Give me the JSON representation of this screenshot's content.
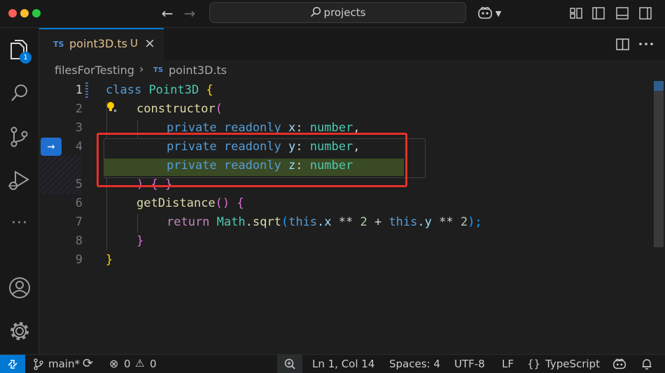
{
  "titlebar": {
    "search_text": "projects",
    "traffic_colors": [
      "#ff5f57",
      "#febc2e",
      "#28c840"
    ]
  },
  "activity": {
    "explorer_badge": "1",
    "more_label": "···"
  },
  "tab": {
    "lang_badge": "TS",
    "file_name": "point3D.ts",
    "status": "U",
    "close": "×"
  },
  "breadcrumb": {
    "folder": "filesForTesting",
    "separator": "›",
    "lang_badge": "TS",
    "file": "point3D.ts"
  },
  "editor": {
    "line_numbers": [
      "1",
      "2",
      "3",
      "4",
      "5",
      "6",
      "7",
      "8",
      "9"
    ],
    "code": {
      "l1_kw": "class",
      "l1_cls": "Point3D",
      "l1_br": "{",
      "l2_fn": "constructor",
      "l2_br": "(",
      "l3_kw": "private readonly",
      "l3_var": "x",
      "l3_sep": ":",
      "l3_type": "number",
      "l3_comma": ",",
      "l4_kw": "private readonly",
      "l4_var": "y",
      "l4_sep": ":",
      "l4_type": "number",
      "l4_comma": ",",
      "l5_kw": "private readonly",
      "l5_var": "z",
      "l5_sep": ":",
      "l5_type": "number",
      "l5_close_paren": ")",
      "l5_braces": "{ }",
      "l6_fn": "getDistance",
      "l6_paren": "()",
      "l6_br": "{",
      "l7_kw": "return",
      "l7_cls": "Math",
      "l7_dot": ".",
      "l7_fn": "sqrt",
      "l7_open": "(",
      "l7_this1": "this",
      "l7_x": ".x",
      "l7_pow1": " ** ",
      "l7_n1": "2",
      "l7_plus": " + ",
      "l7_this2": "this",
      "l7_y": ".y",
      "l7_pow2": " ** ",
      "l7_n2": "2",
      "l7_close": ");",
      "l8_br": "}",
      "l9_br": "}"
    },
    "gutter_arrow": "→"
  },
  "statusbar": {
    "branch": "main*",
    "errors": "0",
    "warnings": "0",
    "position": "Ln 1, Col 14",
    "spaces": "Spaces: 4",
    "encoding": "UTF-8",
    "eol": "LF",
    "braces": "{}",
    "language": "TypeScript"
  },
  "colors": {
    "accent": "#0078d4",
    "highlight_box": "#e5302a",
    "modified_file": "#e2c08d"
  }
}
